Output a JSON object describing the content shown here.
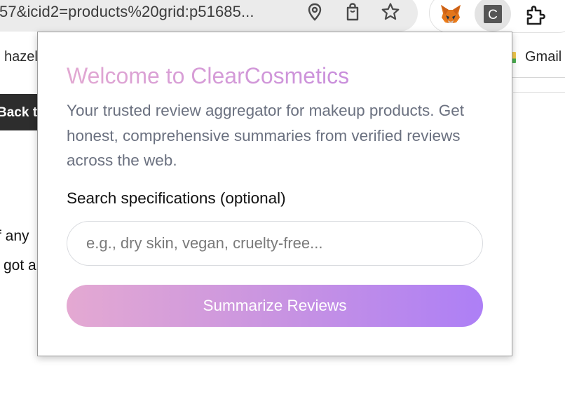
{
  "browser": {
    "url_text": "57&icid2=products%20grid:p51685...",
    "omnibox_icons": [
      "location-pin-icon",
      "shopping-bag-icon",
      "star-icon"
    ],
    "extensions": [
      {
        "name": "fox-extension-icon",
        "letter": ""
      },
      {
        "name": "clearcosmetics-extension-icon",
        "letter": "C"
      },
      {
        "name": "puzzle-extensions-icon",
        "letter": ""
      }
    ]
  },
  "bookmarks": {
    "left_item": "hazel",
    "right_item": "Gmail"
  },
  "page": {
    "back_button": "Back to",
    "text_line_1": "f any",
    "text_line_2": "got a"
  },
  "popup": {
    "title": "Welcome to ClearCosmetics",
    "description": "Your trusted review aggregator for makeup products. Get honest, comprehensive summaries from verified reviews across the web.",
    "search_label": "Search specifications (optional)",
    "search_placeholder": "e.g., dry skin, vegan, cruelty-free...",
    "search_value": "",
    "button_label": "Summarize Reviews",
    "colors": {
      "title_gradient_start": "#e2a8d2",
      "title_gradient_end": "#c98fdc",
      "button_gradient_start": "#e4a9d2",
      "button_gradient_end": "#ad7ff6",
      "description_text": "#6b7180"
    }
  }
}
